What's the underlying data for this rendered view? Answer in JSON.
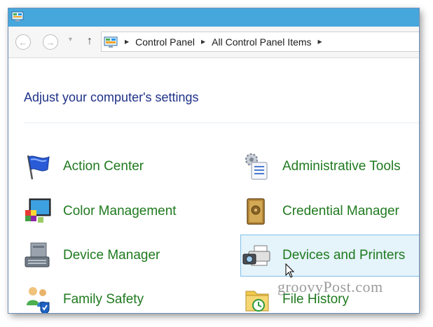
{
  "window": {
    "title_icon": "control-panel-icon"
  },
  "navigation": {
    "back_icon": "back-arrow-icon",
    "forward_icon": "forward-arrow-icon",
    "recent_icon": "chevron-down-icon",
    "up_icon": "up-arrow-icon",
    "breadcrumb": [
      {
        "label": "Control Panel"
      },
      {
        "label": "All Control Panel Items"
      }
    ]
  },
  "header": {
    "title": "Adjust your computer's settings"
  },
  "items": [
    {
      "label": "Action Center",
      "icon": "action-center-flag-icon"
    },
    {
      "label": "Administrative Tools",
      "icon": "administrative-tools-icon"
    },
    {
      "label": "Color Management",
      "icon": "color-management-icon"
    },
    {
      "label": "Credential Manager",
      "icon": "credential-manager-safe-icon"
    },
    {
      "label": "Device Manager",
      "icon": "device-manager-icon"
    },
    {
      "label": "Devices and Printers",
      "icon": "printer-camera-icon",
      "state": "hovered"
    },
    {
      "label": "Family Safety",
      "icon": "family-safety-icon"
    },
    {
      "label": "File History",
      "icon": "file-history-folder-icon"
    }
  ],
  "watermark": {
    "text": "groovyPost.com"
  },
  "colors": {
    "titlebar": "#46a7dc",
    "page_title": "#1e3287",
    "item_label": "#1f7a1f",
    "hover_bg": "#e5f3fb",
    "hover_border": "#7fc0e8"
  }
}
